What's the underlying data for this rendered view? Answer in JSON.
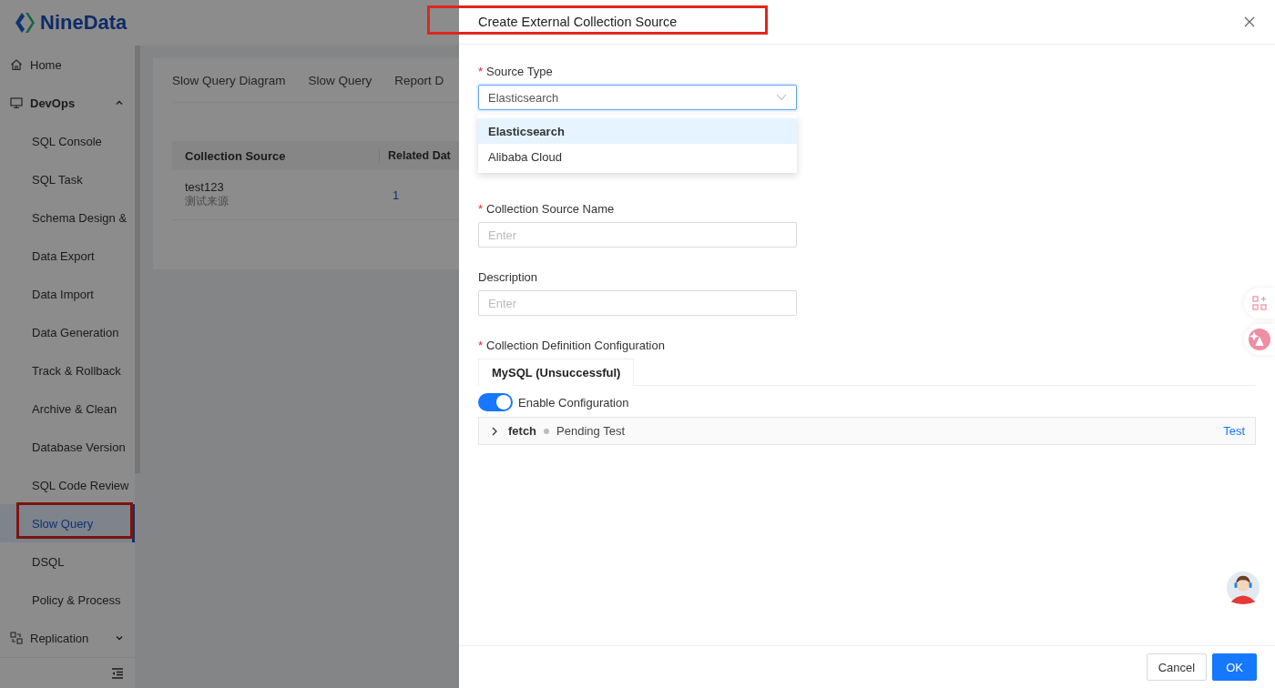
{
  "app": {
    "logo": "NineData"
  },
  "sidebar": {
    "items": [
      {
        "label": "Home"
      },
      {
        "label": "DevOps",
        "expanded": true,
        "children": [
          {
            "label": "SQL Console",
            "selected": false,
            "highlighted": false
          },
          {
            "label": "SQL Task",
            "selected": false,
            "highlighted": false
          },
          {
            "label": "Schema Design &",
            "selected": false,
            "highlighted": false
          },
          {
            "label": "Data Export",
            "selected": false,
            "highlighted": false
          },
          {
            "label": "Data Import",
            "selected": false,
            "highlighted": false
          },
          {
            "label": "Data Generation",
            "selected": false,
            "highlighted": false
          },
          {
            "label": "Track & Rollback",
            "selected": false,
            "highlighted": false
          },
          {
            "label": "Archive & Clean",
            "selected": false,
            "highlighted": false
          },
          {
            "label": "Database Version",
            "selected": false,
            "highlighted": false
          },
          {
            "label": "SQL Code Review",
            "selected": false,
            "highlighted": false
          },
          {
            "label": "Slow Query",
            "selected": true,
            "highlighted": true
          },
          {
            "label": "DSQL",
            "selected": false,
            "highlighted": false
          },
          {
            "label": "Policy & Process",
            "selected": false,
            "highlighted": false
          }
        ]
      },
      {
        "label": "Replication",
        "expanded": false
      }
    ]
  },
  "content": {
    "tabs": [
      "Slow Query Diagram",
      "Slow Query",
      "Report D"
    ],
    "table": {
      "columns": [
        "Collection Source",
        "Related Dat"
      ],
      "rows": [
        {
          "name": "test123",
          "description": "测试来源",
          "count": "1"
        }
      ]
    }
  },
  "drawer": {
    "title": "Create External Collection Source",
    "title_highlighted": true,
    "source_type": {
      "label": "Source Type",
      "required_mark": "*",
      "value": "Elasticsearch",
      "options": [
        {
          "label": "Elasticsearch",
          "selected": true
        },
        {
          "label": "Alibaba Cloud",
          "selected": false
        }
      ]
    },
    "fields": [
      {
        "label": "Collection Source Name",
        "required_mark": "*",
        "placeholder": "Enter"
      },
      {
        "label": "Description",
        "placeholder": "Enter"
      }
    ],
    "config": {
      "label": "Collection Definition Configuration",
      "required_mark": "*",
      "tabs": [
        {
          "label": "MySQL  (Unsuccessful)",
          "selected": true
        }
      ],
      "toggle": {
        "label": "Enable Configuration",
        "on": true
      },
      "panel": {
        "expanded": false,
        "name": "fetch",
        "status": "Pending Test",
        "action": "Test"
      }
    },
    "buttons": [
      {
        "label": "Cancel",
        "kind": "default"
      },
      {
        "label": "OK",
        "kind": "primary"
      }
    ]
  }
}
